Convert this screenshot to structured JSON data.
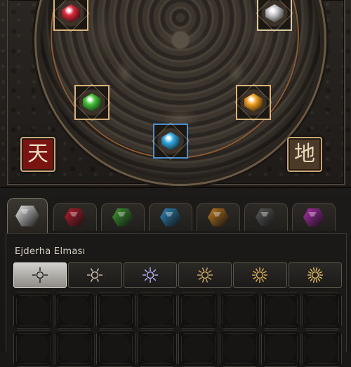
{
  "disc": {
    "gems": [
      {
        "name": "ruby",
        "color": "#d8283a",
        "frame": "#d9b27a"
      },
      {
        "name": "onyx",
        "color": "#c9c9c9",
        "frame": "#d9c8a0"
      },
      {
        "name": "emerald",
        "color": "#46c038",
        "frame": "#d9b27a"
      },
      {
        "name": "topaz",
        "color": "#f2a020",
        "frame": "#d9b27a"
      },
      {
        "name": "sapphire",
        "color": "#34a8e0",
        "frame": "#4b8fd0"
      }
    ],
    "rune_heaven": {
      "char": "天",
      "bg": "#7a1410",
      "fg": "#f0e0c8"
    },
    "rune_earth": {
      "char": "地",
      "bg": "#4c3a28",
      "fg": "#e9d8b8"
    }
  },
  "tabs": [
    {
      "gem": "diamond",
      "color": "#e8e8e8",
      "active": true
    },
    {
      "gem": "ruby",
      "color": "#b81e2c",
      "active": false
    },
    {
      "gem": "emerald",
      "color": "#3f9a32",
      "active": false
    },
    {
      "gem": "sapphire",
      "color": "#2f86b8",
      "active": false
    },
    {
      "gem": "topaz",
      "color": "#c07a1e",
      "active": false
    },
    {
      "gem": "onyx",
      "color": "#5a5a5a",
      "active": false
    },
    {
      "gem": "amethyst",
      "color": "#b02eb0",
      "active": false
    }
  ],
  "section": {
    "title": "Ejderha Elması"
  },
  "grades": [
    {
      "icon": "grade-1-icon",
      "selected": true,
      "stroke": "#f4f2ee"
    },
    {
      "icon": "grade-2-icon",
      "selected": false,
      "stroke": "#cfc6b4"
    },
    {
      "icon": "grade-3-icon",
      "selected": false,
      "stroke": "#b9b6ff"
    },
    {
      "icon": "grade-4-icon",
      "selected": false,
      "stroke": "#d6b06a"
    },
    {
      "icon": "grade-5-icon",
      "selected": false,
      "stroke": "#e0b050"
    },
    {
      "icon": "grade-6-icon",
      "selected": false,
      "stroke": "#e8c060"
    }
  ],
  "slot_count": 16
}
